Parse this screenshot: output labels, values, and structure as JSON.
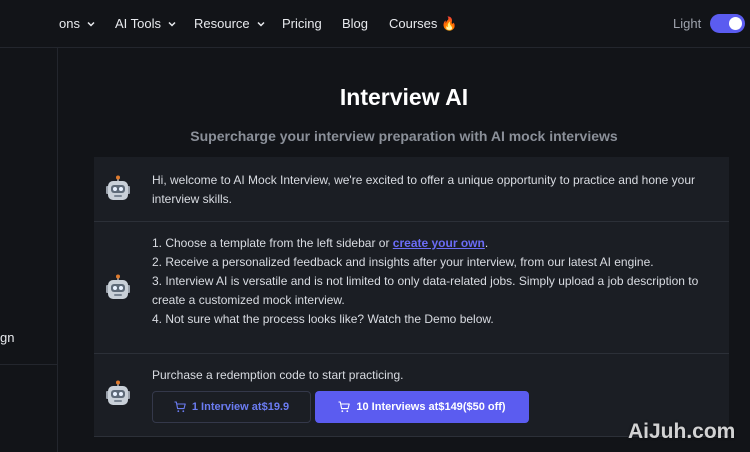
{
  "nav": {
    "items": [
      {
        "label": "ons",
        "dropdown": true
      },
      {
        "label": "AI Tools",
        "dropdown": true
      },
      {
        "label": "Resource",
        "dropdown": true
      },
      {
        "label": "Pricing",
        "dropdown": false
      },
      {
        "label": "Blog",
        "dropdown": false
      },
      {
        "label": "Courses 🔥",
        "dropdown": false
      }
    ],
    "theme_label": "Light",
    "theme_toggle_on": true
  },
  "sidebar": {
    "partial_label": "gn"
  },
  "page": {
    "title": "Interview AI",
    "subtitle": "Supercharge your interview preparation with AI mock interviews"
  },
  "messages": [
    {
      "icon": "robot-icon",
      "text": "Hi, welcome to AI Mock Interview, we're excited to offer a unique opportunity to practice and hone your interview skills."
    },
    {
      "icon": "robot-icon",
      "lines": [
        {
          "before": "1. Choose a template from the left sidebar or ",
          "link": "create your own",
          "after": "."
        },
        {
          "text": "2. Receive a personalized feedback and insights after your interview, from our latest AI engine."
        },
        {
          "text": "3. Interview AI is versatile and is not limited to only data-related jobs. Simply upload a job description to create a customized mock interview."
        },
        {
          "text": "4. Not sure what the process looks like? Watch the Demo below."
        }
      ]
    },
    {
      "icon": "robot-icon",
      "text": "Purchase a redemption code to start practicing.",
      "buttons": [
        {
          "label_prefix": "1 Interview at ",
          "label_price": "$19.9",
          "label_suffix": ""
        },
        {
          "label_prefix": "10 Interviews at ",
          "label_price": "$149",
          "label_suffix": "($50 off)"
        }
      ]
    }
  ],
  "watermark": "AiJuh.com",
  "colors": {
    "background": "#121418",
    "card": "#1b1e24",
    "accent": "#5b5cf0",
    "link": "#6b6cf6",
    "muted": "#8b9099"
  }
}
